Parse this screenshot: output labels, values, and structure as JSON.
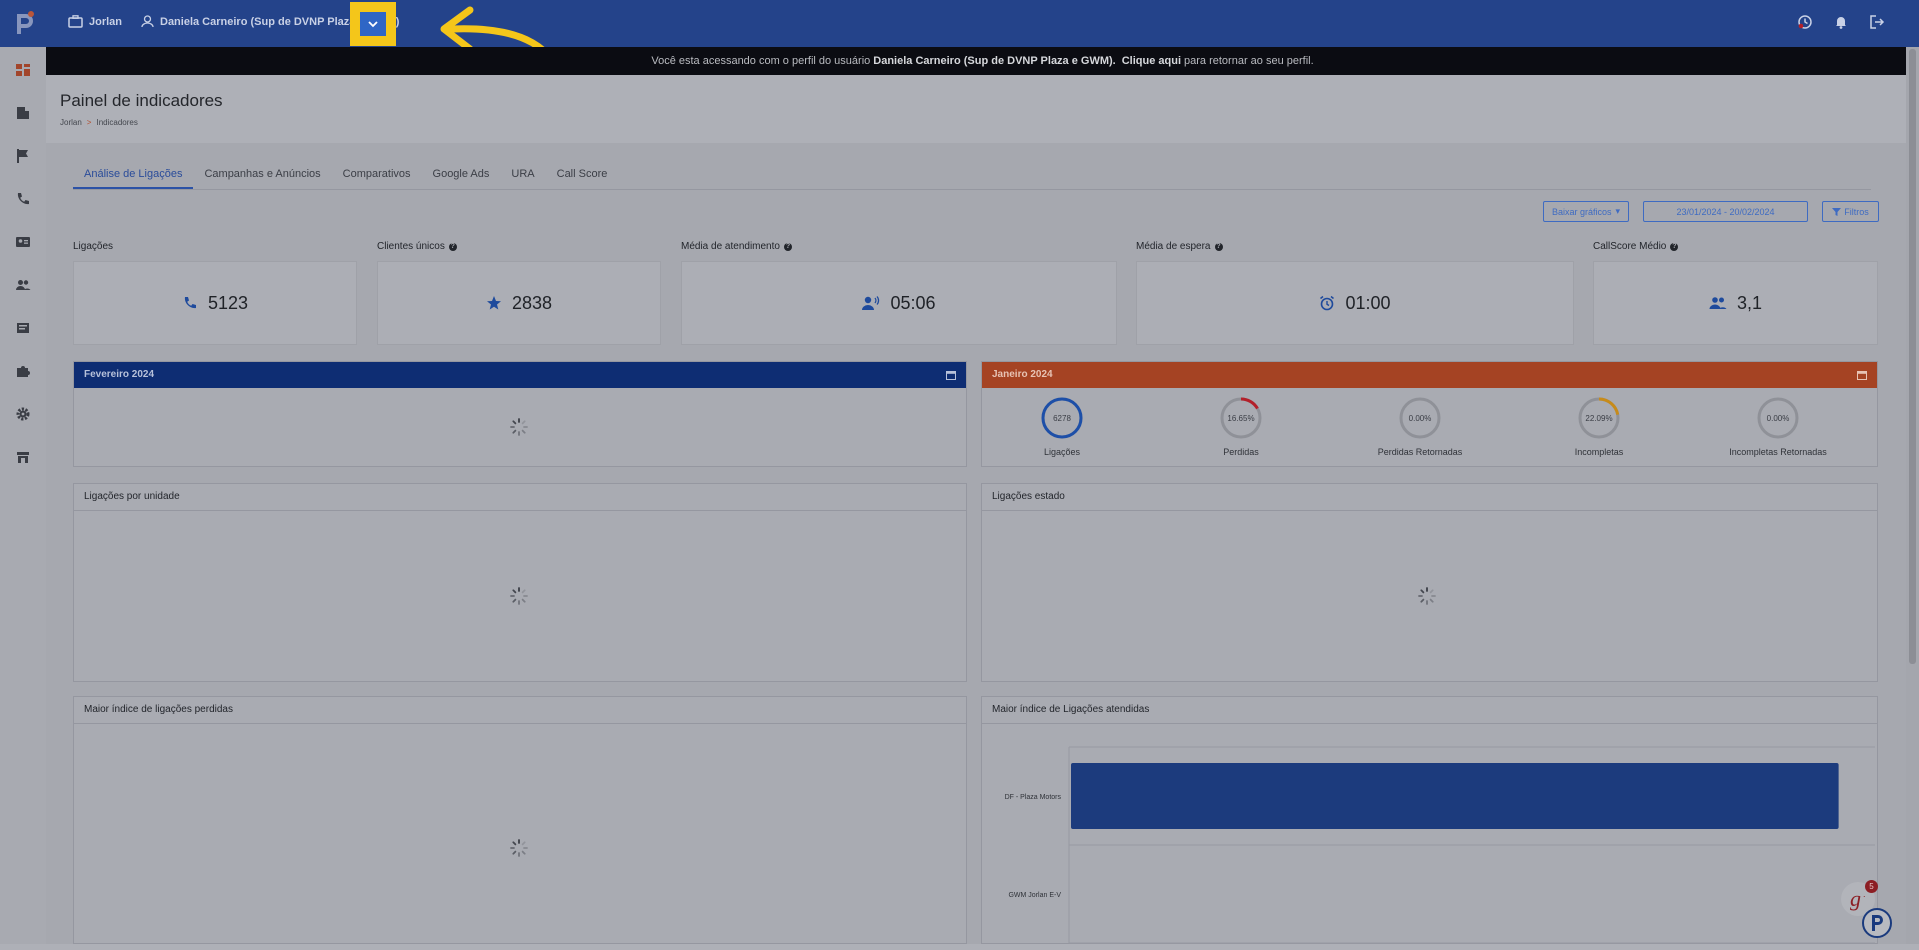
{
  "topbar": {
    "company": "Jorlan",
    "user": "Daniela Carneiro (Sup de DVNP Plaza e GWM)"
  },
  "banner": {
    "prefix": "Você esta acessando com o perfil do usuário",
    "user": "Daniela Carneiro (Sup de DVNP Plaza e GWM).",
    "link": "Clique aqui",
    "suffix": "para retornar ao seu perfil."
  },
  "header": {
    "title": "Painel de indicadores",
    "breadcrumb": [
      "Jorlan",
      ">",
      "Indicadores"
    ]
  },
  "tabs": [
    "Análise de Ligações",
    "Campanhas e Anúncios",
    "Comparativos",
    "Google Ads",
    "URA",
    "Call Score"
  ],
  "toolbar": {
    "download": "Baixar gráficos",
    "date_range": "23/01/2024 - 20/02/2024",
    "filters": "Filtros"
  },
  "metrics": [
    {
      "label": "Ligações",
      "value": "5123",
      "icon": "phone-icon"
    },
    {
      "label": "Clientes únicos",
      "value": "2838",
      "icon": "star-icon"
    },
    {
      "label": "Média de atendimento",
      "value": "05:06",
      "icon": "voice-icon"
    },
    {
      "label": "Média de espera",
      "value": "01:00",
      "icon": "alarm-icon"
    },
    {
      "label": "CallScore Médio",
      "value": "3,1",
      "icon": "people-icon"
    }
  ],
  "panels": {
    "feb": {
      "title": "Fevereiro 2024"
    },
    "jan": {
      "title": "Janeiro 2024",
      "gauges": [
        {
          "value": "6278",
          "label": "Ligações",
          "fraction": 1.0,
          "color": "#1d4fa8"
        },
        {
          "value": "16.65%",
          "label": "Perdidas",
          "fraction": 0.1665,
          "color": "#b3202a"
        },
        {
          "value": "0.00%",
          "label": "Perdidas Retornadas",
          "fraction": 0,
          "color": "#888888"
        },
        {
          "value": "22.09%",
          "label": "Incompletas",
          "fraction": 0.2209,
          "color": "#c78b1a"
        },
        {
          "value": "0.00%",
          "label": "Incompletas Retornadas",
          "fraction": 0,
          "color": "#888888"
        }
      ]
    },
    "por_unidade": {
      "title": "Ligações por unidade"
    },
    "estado": {
      "title": "Ligações estado"
    },
    "perdidas": {
      "title": "Maior índice de ligações perdidas"
    },
    "atendidas": {
      "title": "Maior índice de Ligações atendidas"
    }
  },
  "chart_data": {
    "type": "bar",
    "title": "Maior índice de Ligações atendidas",
    "categories": [
      "DF - Plaza Motors",
      "GWM Jorlan E-V"
    ],
    "values": [
      100,
      0
    ],
    "orientation": "horizontal",
    "xlim": [
      0,
      105
    ],
    "grid": true,
    "color": "#1c3b7d"
  },
  "widget": {
    "badge": "5"
  }
}
